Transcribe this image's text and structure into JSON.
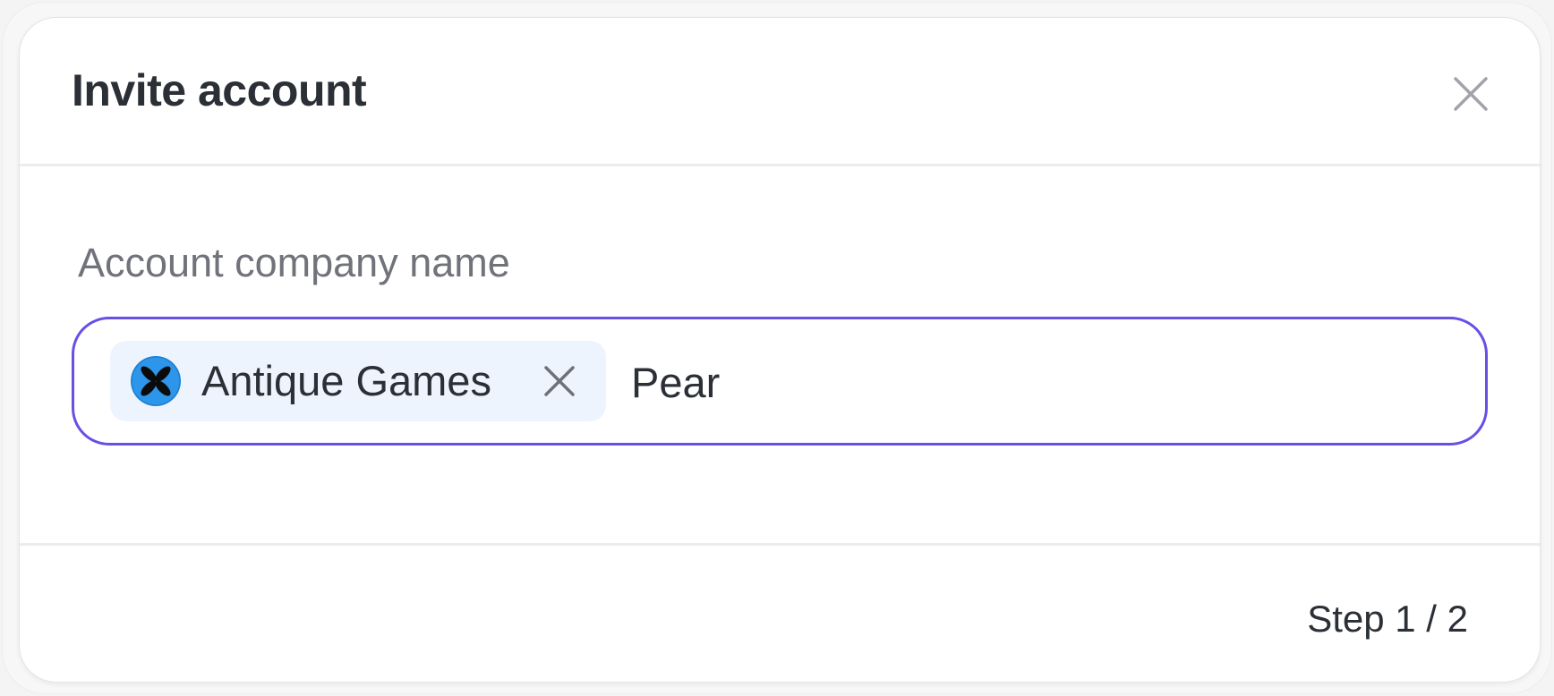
{
  "dialog": {
    "title": "Invite account",
    "close_icon": "close-icon"
  },
  "field": {
    "label": "Account company name",
    "selected_chip": {
      "label": "Antique Games",
      "avatar_icon": "antique-games-logo-icon",
      "remove_icon": "close-icon"
    },
    "input_value": "Pear"
  },
  "footer": {
    "step": "Step 1 / 2"
  },
  "colors": {
    "accent": "#6a4ee6",
    "chip_bg": "#eef4fd",
    "logo_blue": "#2d96ea"
  }
}
